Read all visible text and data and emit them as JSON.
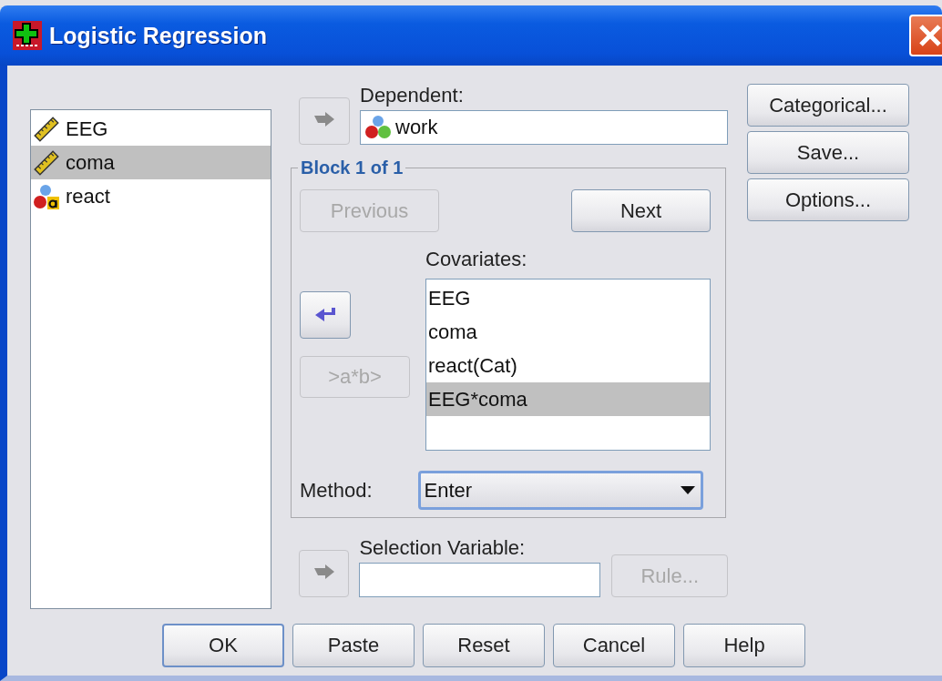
{
  "window": {
    "title": "Logistic Regression"
  },
  "variables": [
    {
      "name": "EEG",
      "kind": "scale",
      "selected": false
    },
    {
      "name": "coma",
      "kind": "scale",
      "selected": true
    },
    {
      "name": "react",
      "kind": "nominal_string",
      "selected": false
    }
  ],
  "dependent": {
    "label": "Dependent:",
    "arrow": {
      "points_left": false,
      "disabled": true
    },
    "value": "work",
    "kind": "nominal"
  },
  "block": {
    "title": "Block 1 of 1",
    "previous": {
      "label": "Previous",
      "disabled": true
    },
    "next": {
      "label": "Next",
      "disabled": false
    },
    "covariates_label": "Covariates:",
    "arrow": {
      "points_left": true,
      "disabled": false
    },
    "interaction": {
      "label": ">a*b>",
      "disabled": true
    },
    "covariates": [
      {
        "label": "EEG",
        "selected": false
      },
      {
        "label": "coma",
        "selected": false
      },
      {
        "label": "react(Cat)",
        "selected": false
      },
      {
        "label": "EEG*coma",
        "selected": true
      }
    ],
    "method": {
      "label": "Method:",
      "value": "Enter"
    }
  },
  "selection": {
    "label": "Selection Variable:",
    "arrow": {
      "points_left": false,
      "disabled": true
    },
    "rule": {
      "label": "Rule...",
      "disabled": true
    }
  },
  "side_buttons": [
    {
      "label": "Categorical...",
      "disabled": false
    },
    {
      "label": "Save...",
      "disabled": false
    },
    {
      "label": "Options...",
      "disabled": false
    }
  ],
  "buttons": [
    {
      "label": "OK",
      "default": true,
      "disabled": false
    },
    {
      "label": "Paste",
      "default": false,
      "disabled": false
    },
    {
      "label": "Reset",
      "default": false,
      "disabled": false
    },
    {
      "label": "Cancel",
      "default": false,
      "disabled": false
    },
    {
      "label": "Help",
      "default": false,
      "disabled": false
    }
  ]
}
